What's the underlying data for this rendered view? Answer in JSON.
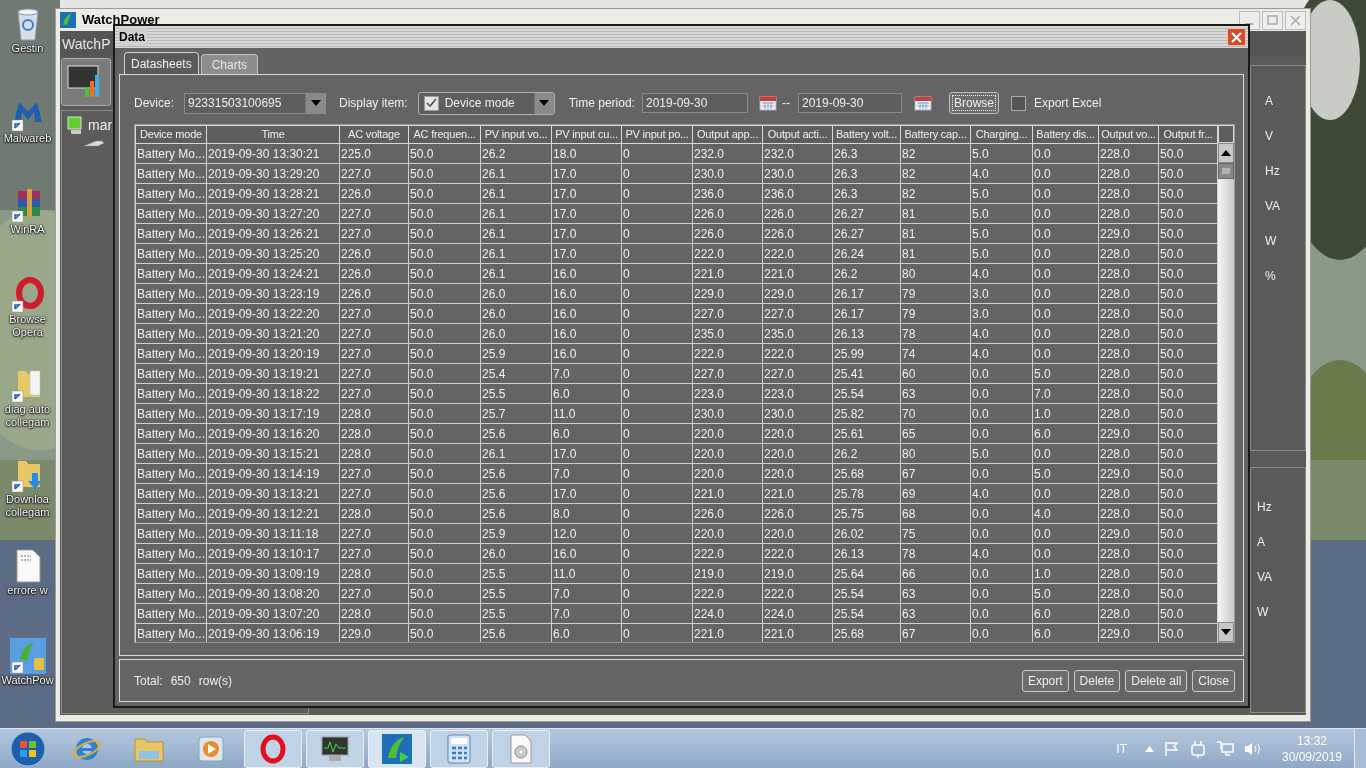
{
  "desktop_icons": [
    {
      "kind": "recycle-bin",
      "label": "Gestin"
    },
    {
      "kind": "malware",
      "label": "Malwareb"
    },
    {
      "kind": "archive",
      "label": "WinRA"
    },
    {
      "kind": "opera",
      "label": "Browse Opera"
    },
    {
      "kind": "folder",
      "label": "diag auto collegam"
    },
    {
      "kind": "folder-download",
      "label": "Downloa collegam"
    },
    {
      "kind": "document",
      "label": "errore w"
    },
    {
      "kind": "watchpower",
      "label": "WatchPow"
    }
  ],
  "main_window": {
    "title": "WatchPower",
    "header": "WatchP",
    "tree": [
      {
        "label": "mar"
      }
    ],
    "units_upper": [
      "A",
      "V",
      "Hz",
      "VA",
      "W",
      "%"
    ],
    "units_lower": [
      "Hz",
      "A",
      "VA",
      "W"
    ]
  },
  "dialog": {
    "title": "Data",
    "tabs": [
      {
        "label": "Datasheets",
        "selected": true
      },
      {
        "label": "Charts",
        "selected": false
      }
    ],
    "device": {
      "label": "Device:",
      "value": "92331503100695"
    },
    "display_item": {
      "label": "Display item:",
      "value": "Device mode",
      "checked": true
    },
    "time_period": {
      "label": "Time period:",
      "from": "2019-09-30",
      "separator": "--",
      "to": "2019-09-30"
    },
    "browse_button": "Browse",
    "export_excel": {
      "label": "Export Excel",
      "checked": false
    },
    "table": {
      "columns": [
        "Device mode",
        "Time",
        "AC voltage",
        "AC frequen...",
        "PV input vo...",
        "PV input cu...",
        "PV input po...",
        "Output app...",
        "Output acti...",
        "Battery volt...",
        "Battery cap...",
        "Charging...",
        "Battery dis...",
        "Output vo...",
        "Output fr..."
      ],
      "rows": [
        [
          "Battery Mo...",
          "2019-09-30 13:30:21",
          "225.0",
          "50.0",
          "26.2",
          "18.0",
          "0",
          "232.0",
          "232.0",
          "26.3",
          "82",
          "5.0",
          "0.0",
          "228.0",
          "50.0"
        ],
        [
          "Battery Mo...",
          "2019-09-30 13:29:20",
          "227.0",
          "50.0",
          "26.1",
          "17.0",
          "0",
          "230.0",
          "230.0",
          "26.3",
          "82",
          "4.0",
          "0.0",
          "228.0",
          "50.0"
        ],
        [
          "Battery Mo...",
          "2019-09-30 13:28:21",
          "226.0",
          "50.0",
          "26.1",
          "17.0",
          "0",
          "236.0",
          "236.0",
          "26.3",
          "82",
          "5.0",
          "0.0",
          "228.0",
          "50.0"
        ],
        [
          "Battery Mo...",
          "2019-09-30 13:27:20",
          "227.0",
          "50.0",
          "26.1",
          "17.0",
          "0",
          "226.0",
          "226.0",
          "26.27",
          "81",
          "5.0",
          "0.0",
          "228.0",
          "50.0"
        ],
        [
          "Battery Mo...",
          "2019-09-30 13:26:21",
          "227.0",
          "50.0",
          "26.1",
          "17.0",
          "0",
          "226.0",
          "226.0",
          "26.27",
          "81",
          "5.0",
          "0.0",
          "229.0",
          "50.0"
        ],
        [
          "Battery Mo...",
          "2019-09-30 13:25:20",
          "226.0",
          "50.0",
          "26.1",
          "17.0",
          "0",
          "222.0",
          "222.0",
          "26.24",
          "81",
          "5.0",
          "0.0",
          "228.0",
          "50.0"
        ],
        [
          "Battery Mo...",
          "2019-09-30 13:24:21",
          "226.0",
          "50.0",
          "26.1",
          "16.0",
          "0",
          "221.0",
          "221.0",
          "26.2",
          "80",
          "4.0",
          "0.0",
          "228.0",
          "50.0"
        ],
        [
          "Battery Mo...",
          "2019-09-30 13:23:19",
          "226.0",
          "50.0",
          "26.0",
          "16.0",
          "0",
          "229.0",
          "229.0",
          "26.17",
          "79",
          "3.0",
          "0.0",
          "228.0",
          "50.0"
        ],
        [
          "Battery Mo...",
          "2019-09-30 13:22:20",
          "227.0",
          "50.0",
          "26.0",
          "16.0",
          "0",
          "227.0",
          "227.0",
          "26.17",
          "79",
          "3.0",
          "0.0",
          "228.0",
          "50.0"
        ],
        [
          "Battery Mo...",
          "2019-09-30 13:21:20",
          "227.0",
          "50.0",
          "26.0",
          "16.0",
          "0",
          "235.0",
          "235.0",
          "26.13",
          "78",
          "4.0",
          "0.0",
          "228.0",
          "50.0"
        ],
        [
          "Battery Mo...",
          "2019-09-30 13:20:19",
          "227.0",
          "50.0",
          "25.9",
          "16.0",
          "0",
          "222.0",
          "222.0",
          "25.99",
          "74",
          "4.0",
          "0.0",
          "228.0",
          "50.0"
        ],
        [
          "Battery Mo...",
          "2019-09-30 13:19:21",
          "227.0",
          "50.0",
          "25.4",
          "7.0",
          "0",
          "227.0",
          "227.0",
          "25.41",
          "60",
          "0.0",
          "5.0",
          "228.0",
          "50.0"
        ],
        [
          "Battery Mo...",
          "2019-09-30 13:18:22",
          "227.0",
          "50.0",
          "25.5",
          "6.0",
          "0",
          "223.0",
          "223.0",
          "25.54",
          "63",
          "0.0",
          "7.0",
          "228.0",
          "50.0"
        ],
        [
          "Battery Mo...",
          "2019-09-30 13:17:19",
          "228.0",
          "50.0",
          "25.7",
          "11.0",
          "0",
          "230.0",
          "230.0",
          "25.82",
          "70",
          "0.0",
          "1.0",
          "228.0",
          "50.0"
        ],
        [
          "Battery Mo...",
          "2019-09-30 13:16:20",
          "228.0",
          "50.0",
          "25.6",
          "6.0",
          "0",
          "220.0",
          "220.0",
          "25.61",
          "65",
          "0.0",
          "6.0",
          "229.0",
          "50.0"
        ],
        [
          "Battery Mo...",
          "2019-09-30 13:15:21",
          "228.0",
          "50.0",
          "26.1",
          "17.0",
          "0",
          "220.0",
          "220.0",
          "26.2",
          "80",
          "5.0",
          "0.0",
          "228.0",
          "50.0"
        ],
        [
          "Battery Mo...",
          "2019-09-30 13:14:19",
          "227.0",
          "50.0",
          "25.6",
          "7.0",
          "0",
          "220.0",
          "220.0",
          "25.68",
          "67",
          "0.0",
          "5.0",
          "229.0",
          "50.0"
        ],
        [
          "Battery Mo...",
          "2019-09-30 13:13:21",
          "227.0",
          "50.0",
          "25.6",
          "17.0",
          "0",
          "221.0",
          "221.0",
          "25.78",
          "69",
          "4.0",
          "0.0",
          "228.0",
          "50.0"
        ],
        [
          "Battery Mo...",
          "2019-09-30 13:12:21",
          "228.0",
          "50.0",
          "25.6",
          "8.0",
          "0",
          "226.0",
          "226.0",
          "25.75",
          "68",
          "0.0",
          "4.0",
          "228.0",
          "50.0"
        ],
        [
          "Battery Mo...",
          "2019-09-30 13:11:18",
          "227.0",
          "50.0",
          "25.9",
          "12.0",
          "0",
          "220.0",
          "220.0",
          "26.02",
          "75",
          "0.0",
          "0.0",
          "229.0",
          "50.0"
        ],
        [
          "Battery Mo...",
          "2019-09-30 13:10:17",
          "227.0",
          "50.0",
          "26.0",
          "16.0",
          "0",
          "222.0",
          "222.0",
          "26.13",
          "78",
          "4.0",
          "0.0",
          "228.0",
          "50.0"
        ],
        [
          "Battery Mo...",
          "2019-09-30 13:09:19",
          "228.0",
          "50.0",
          "25.5",
          "11.0",
          "0",
          "219.0",
          "219.0",
          "25.64",
          "66",
          "0.0",
          "1.0",
          "228.0",
          "50.0"
        ],
        [
          "Battery Mo...",
          "2019-09-30 13:08:20",
          "227.0",
          "50.0",
          "25.5",
          "7.0",
          "0",
          "222.0",
          "222.0",
          "25.54",
          "63",
          "0.0",
          "5.0",
          "228.0",
          "50.0"
        ],
        [
          "Battery Mo...",
          "2019-09-30 13:07:20",
          "228.0",
          "50.0",
          "25.5",
          "7.0",
          "0",
          "224.0",
          "224.0",
          "25.54",
          "63",
          "0.0",
          "6.0",
          "228.0",
          "50.0"
        ],
        [
          "Battery Mo...",
          "2019-09-30 13:06:19",
          "229.0",
          "50.0",
          "25.6",
          "6.0",
          "0",
          "221.0",
          "221.0",
          "25.68",
          "67",
          "0.0",
          "6.0",
          "229.0",
          "50.0"
        ]
      ]
    },
    "total": {
      "label": "Total:",
      "count": "650",
      "unit": "row(s)"
    },
    "buttons": [
      "Export",
      "Delete",
      "Delete all",
      "Close"
    ]
  },
  "taskbar": {
    "apps": [
      {
        "kind": "browser-e",
        "running": false,
        "selected": false
      },
      {
        "kind": "folder",
        "running": false,
        "selected": false
      },
      {
        "kind": "media",
        "running": false,
        "selected": false
      },
      {
        "kind": "opera",
        "running": true,
        "selected": false
      },
      {
        "kind": "monitor",
        "running": true,
        "selected": false
      },
      {
        "kind": "watchpower",
        "running": true,
        "selected": true
      },
      {
        "kind": "calculator",
        "running": true,
        "selected": false
      },
      {
        "kind": "disc",
        "running": true,
        "selected": false
      }
    ],
    "language": "IT",
    "time": "13:32",
    "date": "30/09/2019"
  }
}
